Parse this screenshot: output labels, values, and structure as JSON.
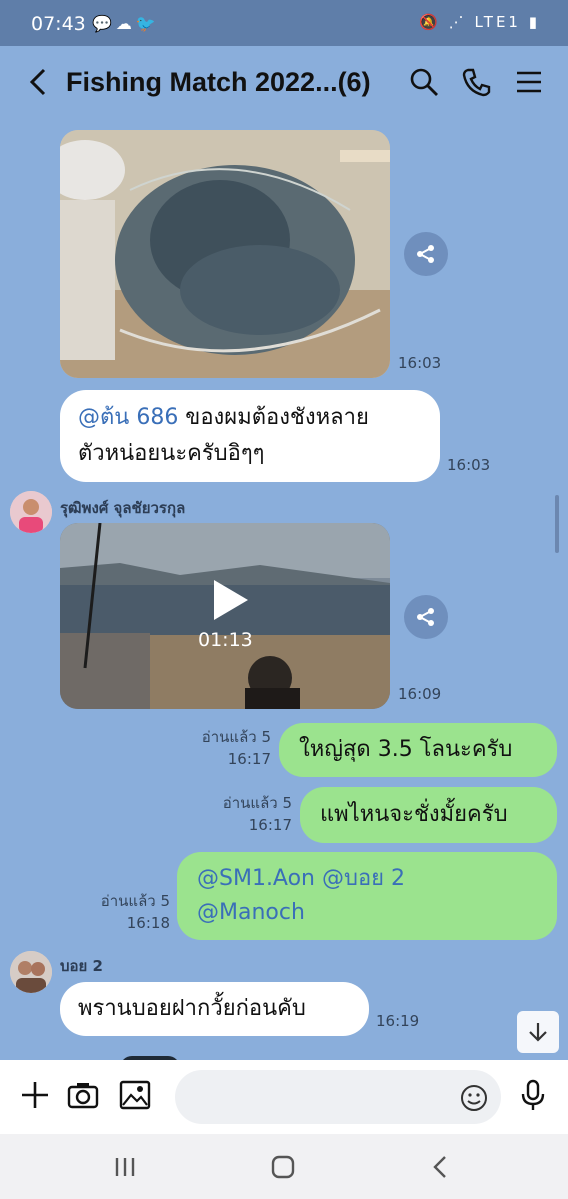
{
  "status": {
    "time": "07:43",
    "left_icons": "💬☁🐦",
    "right_icons": "🔕 ⋰ LTE1 ▮"
  },
  "header": {
    "title": "Fishing Match 2022...(6)"
  },
  "messages": {
    "photo1": {
      "time": "16:03"
    },
    "m1": {
      "mention": "@ต้น 686",
      "text_line1": " ของผมต้องชังหลาย",
      "text_line2": "ตัวหน่อยนะครับอิๆๆ",
      "time": "16:03"
    },
    "sender1": {
      "name": "รุฒิพงศ์ จุลชัยวรกุล"
    },
    "video1": {
      "duration": "01:13",
      "time": "16:09"
    },
    "m2": {
      "text": "ใหญ่สุด 3.5 โลนะครับ",
      "read": "อ่านแล้ว 5",
      "time": "16:17"
    },
    "m3": {
      "text": "แพไหนจะชั่งมั้ยครับ",
      "read": "อ่านแล้ว 5",
      "time": "16:17"
    },
    "m4": {
      "line1": "@SM1.Aon @บอย 2",
      "line2": "@Manoch",
      "read": "อ่านแล้ว 5",
      "time": "16:18"
    },
    "sender2": {
      "name": "บอย 2"
    },
    "m5": {
      "text": "พรานบอยฝากวั้ยก่อนคับ",
      "time": "16:19"
    }
  },
  "input": {
    "placeholder": ""
  },
  "colors": {
    "chat_bg": "#8aaedb",
    "outgoing": "#9be38e",
    "incoming": "#ffffff",
    "mention": "#3a6fb8"
  }
}
